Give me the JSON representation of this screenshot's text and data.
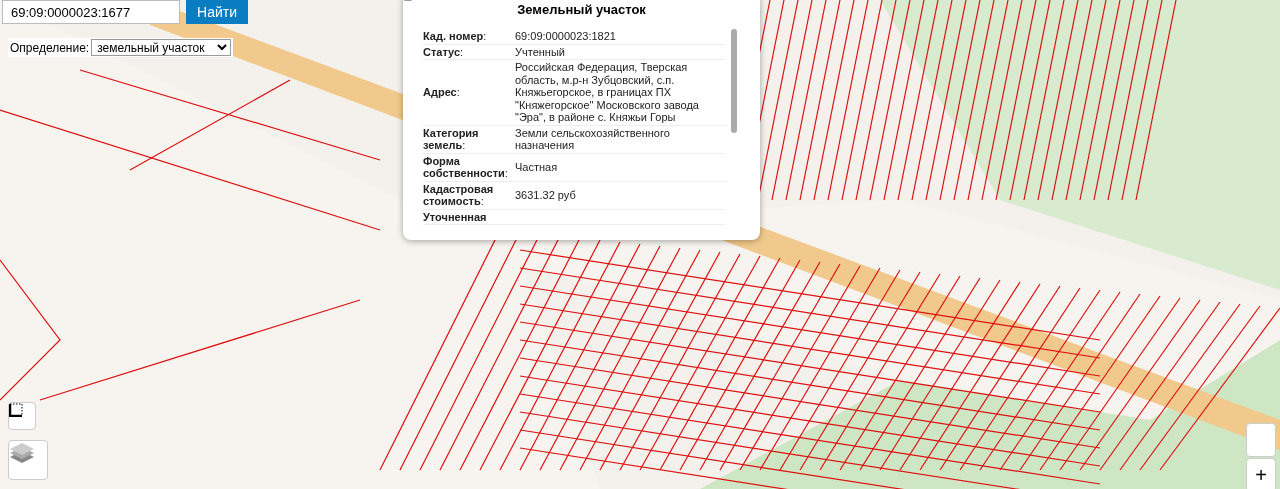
{
  "search": {
    "value": "69:09:0000023:1677",
    "button": "Найти"
  },
  "definition": {
    "label": "Определение:",
    "value": "земельный участок"
  },
  "popup": {
    "title": "Земельный участок",
    "rows": [
      {
        "label": "**Кад. номер**:",
        "value": "69:09:0000023:1821"
      },
      {
        "label": "**Статус**:",
        "value": "Учтенный"
      },
      {
        "label": "**Адрес**:",
        "value": "Российская Федерация, Тверская область, м.р-н Зубцовский, с.п. Княжьегорское, в границах ПХ \"Княжегорское\" Московского завода \"Эра\", в районе с. Княжьи Горы"
      },
      {
        "label": "**Категория земель**:",
        "value": "Земли сельскохозяйственного назначения"
      },
      {
        "label": "**Форма собственности**:",
        "value": "Частная"
      },
      {
        "label": "**Кадастровая стоимость**:",
        "value": "3631.32 руб"
      },
      {
        "label": "**Уточненная**",
        "value": ""
      }
    ]
  },
  "zoom": {
    "in": "+"
  }
}
